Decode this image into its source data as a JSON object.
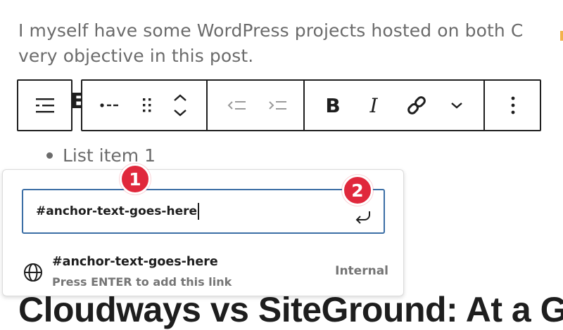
{
  "paragraph": {
    "line1": "I myself have some WordPress projects hosted on both C",
    "line2": "very objective in this post."
  },
  "toolbar": {
    "parent_block_icon": "list-block-icon",
    "block_type_icon": "unordered-list-icon",
    "drag_icon": "drag-handle-icon",
    "move_icons": [
      "chevron-up-icon",
      "chevron-down-icon"
    ],
    "outdent_icon": "outdent-icon",
    "indent_icon": "indent-icon",
    "bold_label": "B",
    "italic_label": "I",
    "link_icon": "link-icon",
    "more_rich_text_icon": "chevron-down-icon",
    "options_icon": "more-vertical-icon"
  },
  "list": {
    "items": [
      "List item 1"
    ]
  },
  "link_popover": {
    "input_value": "#anchor-text-goes-here",
    "submit_icon": "enter-return-icon",
    "suggestion": {
      "icon": "globe-icon",
      "title": "#anchor-text-goes-here",
      "hint": "Press ENTER to add this link",
      "type": "Internal"
    }
  },
  "background_heading": "Cloudways vs SiteGround: At a G",
  "callouts": [
    "1",
    "2"
  ],
  "colors": {
    "input_border": "#3b6ea5",
    "badge": "#e0283c",
    "text_dark": "#1e1e1e",
    "text_muted": "#757575"
  }
}
